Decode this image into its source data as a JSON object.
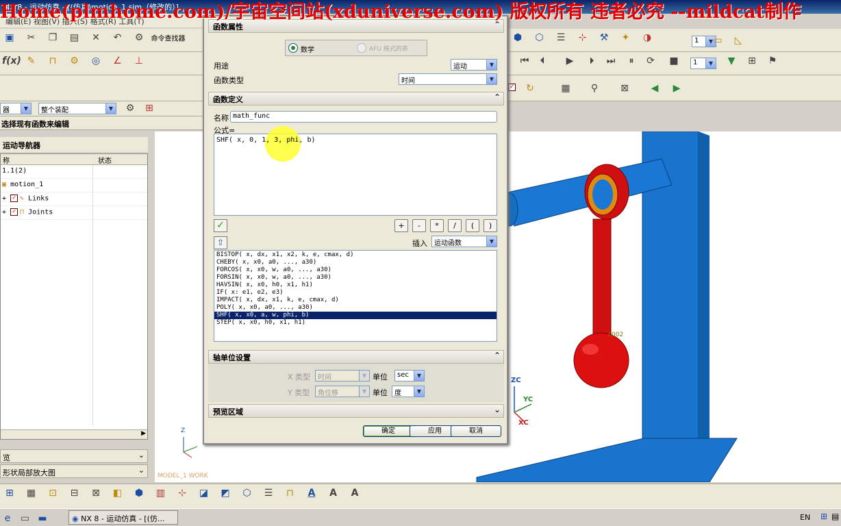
{
  "window_title": "NX 8 - 运动仿真 - [(仿真)motion_1.sim（修改的）]",
  "watermark": "Home(plmhome.com)/宇宙空间站(xduniverse.com) 版权所有 违者必究 --mildcat制作",
  "menubar_text": "编辑(E)  视图(V)  插入(S)  格式(R)  工具(T)",
  "toolbar": {
    "command_finder": "命令查找器",
    "selection_filter": "器",
    "assembly_scope": "整个装配",
    "playback_step": "1"
  },
  "left_panel": {
    "hint": "选择现有函数来编辑",
    "title": "运动导航器",
    "col_name": "称",
    "col_status": "状态",
    "rows": [
      {
        "label": "1.1(2)"
      },
      {
        "label": "motion_1"
      },
      {
        "label": "Links"
      },
      {
        "label": "Joints"
      }
    ],
    "bottom1": "览",
    "bottom2": "形状局部放大图"
  },
  "viewport": {
    "model_label": "MODEL_1 WORK",
    "axis_zc": "ZC",
    "axis_yc": "YC",
    "axis_xc": "XC",
    "axis_z": "Z",
    "link_label": "L002"
  },
  "dialog": {
    "title": "函数",
    "sec_properties": "函数属性",
    "radio_math": "数学",
    "radio_afu": "AFU 格式的表",
    "purpose_label": "用途",
    "purpose_value": "运动",
    "type_label": "函数类型",
    "type_value": "时间",
    "sec_definition": "函数定义",
    "name_label": "名称",
    "name_value": "math_func",
    "formula_label": "公式=",
    "formula_value": "SHF( x, 0, 1, 3, phi, b)",
    "ops": [
      "+",
      "-",
      "*",
      "/",
      "(",
      ")"
    ],
    "insert_label": "插入",
    "insert_value": "运动函数",
    "functions": [
      "BISTOP( x, dx, x1, x2, k, e, cmax, d)",
      "CHEBY( x, x0, a0, ..., a30)",
      "FORCOS( x, x0, w, a0, ..., a30)",
      "FORSIN( x, x0, w, a0, ..., a30)",
      "HAVSIN( x, x0, h0, x1, h1)",
      "IF( x: e1, e2, e3)",
      "IMPACT( x, dx, x1, k, e, cmax, d)",
      "POLY( x, x0, a0, ..., a30)",
      "SHF( x, x0, a, w, phi, b)",
      "STEP( x, x0, h0, x1, h1)"
    ],
    "selected_function_index": 8,
    "sec_units": "轴单位设置",
    "x_type_label": "X 类型",
    "x_type_value": "时间",
    "x_unit_label": "单位",
    "x_unit_value": "sec",
    "y_type_label": "Y 类型",
    "y_type_value": "角位移",
    "y_unit_label": "单位",
    "y_unit_value": "度",
    "sec_preview": "预览区域",
    "ok": "确定",
    "apply": "应用",
    "cancel": "取消"
  },
  "taskbar": {
    "task_label": "NX 8 - 运动仿真 - [(仿...",
    "lang": "EN"
  }
}
